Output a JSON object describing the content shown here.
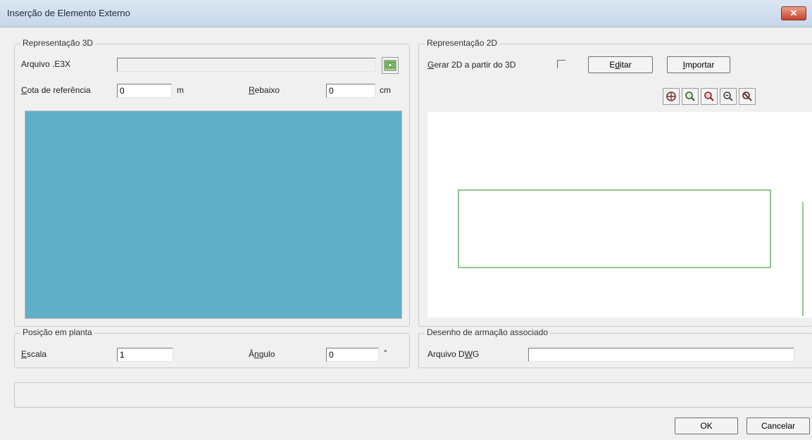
{
  "window": {
    "title": "Inserção de Elemento Externo",
    "close_label": "✕"
  },
  "rep3d": {
    "legend": "Representação 3D",
    "arquivo_label": "Arquivo .E3X",
    "arquivo_value": "",
    "cota_label_rest": "ota de referência",
    "cota_label_key": "C",
    "cota_value": "0",
    "cota_unit": "m",
    "rebaixo_label_key": "R",
    "rebaixo_label_rest": "ebaixo",
    "rebaixo_value": "0",
    "rebaixo_unit": "cm",
    "preview_color": "#61aec8"
  },
  "rep2d": {
    "legend": "Representação 2D",
    "gerar_label_key": "G",
    "gerar_label_rest": "erar 2D a partir do 3D",
    "gerar_checked": false,
    "editar_pre": "E",
    "editar_key": "d",
    "editar_post": "itar",
    "importar_key": "I",
    "importar_rest": "mportar",
    "toolbar_icons": [
      "pan-icon",
      "zoom-window-icon",
      "zoom-extents-icon",
      "zoom-out-icon",
      "refresh-view-icon"
    ],
    "drawing_color": "#6bb46b"
  },
  "posicao": {
    "legend": "Posição em planta",
    "escala_key": "E",
    "escala_rest": "scala",
    "escala_value": "1",
    "angulo_pre": "Â",
    "angulo_key": "n",
    "angulo_post": "gulo",
    "angulo_value": "0",
    "angulo_unit": "°"
  },
  "desenho": {
    "legend": "Desenho de armação associado",
    "arquivo_pre": "Arquivo D",
    "arquivo_key": "W",
    "arquivo_post": "G",
    "arquivo_value": ""
  },
  "status": {
    "text": ""
  },
  "footer": {
    "ok_label": "OK",
    "cancel_label": "Cancelar"
  }
}
